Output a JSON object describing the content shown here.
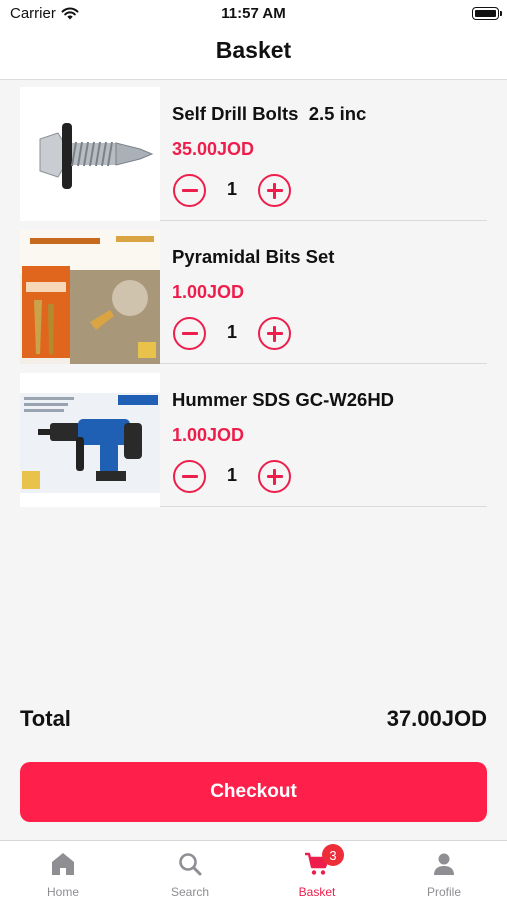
{
  "status_bar": {
    "carrier": "Carrier",
    "time": "11:57 AM"
  },
  "nav": {
    "title": "Basket"
  },
  "items": [
    {
      "name": "Self Drill Bolts  2.5 inc",
      "price": "35.00JOD",
      "quantity": "1",
      "image_icon": "bolt-image"
    },
    {
      "name": "Pyramidal Bits Set",
      "price": "1.00JOD",
      "quantity": "1",
      "image_icon": "bits-set-image"
    },
    {
      "name": "Hummer SDS GC-W26HD",
      "price": "1.00JOD",
      "quantity": "1",
      "image_icon": "hammer-drill-image"
    }
  ],
  "total": {
    "label": "Total",
    "value": "37.00JOD"
  },
  "checkout": {
    "label": "Checkout"
  },
  "tabs": [
    {
      "label": "Home",
      "icon": "home-icon",
      "active": false
    },
    {
      "label": "Search",
      "icon": "search-icon",
      "active": false
    },
    {
      "label": "Basket",
      "icon": "cart-icon",
      "active": true,
      "badge": "3"
    },
    {
      "label": "Profile",
      "icon": "person-icon",
      "active": false
    }
  ],
  "colors": {
    "accent": "#ee1e4c",
    "button": "#ff1f4b",
    "inactive": "#8e8e93",
    "background": "#f5f5f5"
  }
}
